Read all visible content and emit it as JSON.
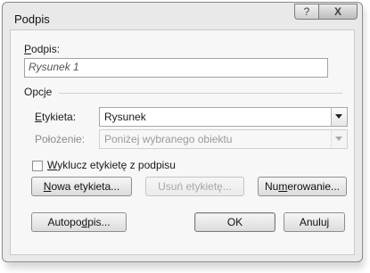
{
  "window": {
    "title": "Podpis",
    "help_glyph": "?",
    "close_glyph": "X"
  },
  "caption": {
    "label_pre": "",
    "label_key": "P",
    "label_post": "odpis:",
    "value": "Rysunek 1"
  },
  "options": {
    "group_label": "Opcje",
    "label_field": {
      "label_pre": "",
      "label_key": "E",
      "label_post": "tykieta:",
      "value": "Rysunek"
    },
    "position_field": {
      "label": "Położenie:",
      "value": "Poniżej wybranego obiektu",
      "disabled": true
    },
    "exclude_checkbox": {
      "label_pre": "",
      "label_key": "W",
      "label_post": "yklucz etykietę z podpisu",
      "checked": false
    }
  },
  "buttons": {
    "new_label": {
      "pre": "",
      "key": "N",
      "post": "owa etykieta..."
    },
    "delete_label": {
      "text": "Usuń etykietę...",
      "disabled": true
    },
    "numbering": {
      "pre": "Nu",
      "key": "m",
      "post": "erowanie..."
    },
    "autocaption": {
      "pre": "Autopo",
      "key": "d",
      "post": "pis..."
    },
    "ok": "OK",
    "cancel": "Anuluj"
  }
}
